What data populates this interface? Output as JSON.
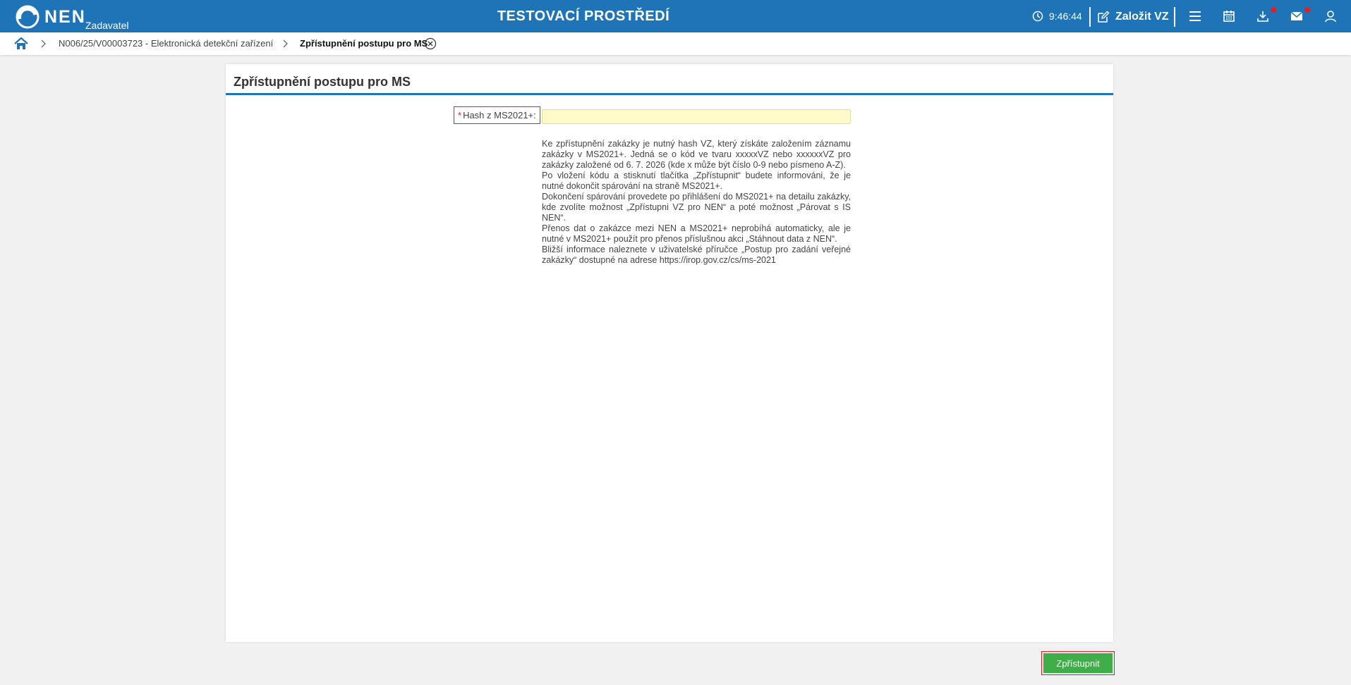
{
  "header": {
    "brand": "NEN",
    "role": "Zadavatel",
    "environment_title": "TESTOVACÍ PROSTŘEDÍ",
    "time": "9:46:44",
    "create_label": "Založit VZ",
    "icons": [
      "clock-icon",
      "edit-icon",
      "menu-icon",
      "calendar-icon",
      "download-icon",
      "mail-icon",
      "user-icon"
    ],
    "accent_color": "#1f73b7"
  },
  "breadcrumb": {
    "items": [
      "N006/25/V00003723 - Elektronická detekční zařízení",
      "Zpřístupnění postupu pro MS"
    ]
  },
  "panel": {
    "title": "Zpřístupnění postupu pro MS",
    "field": {
      "label": "Hash z MS2021+:",
      "required_mark": "*",
      "value": "",
      "placeholder": ""
    },
    "info": [
      "Ke zpřístupnění zakázky je nutný hash VZ, který získáte založením záznamu zakázky v MS2021+. Jedná se o kód ve tvaru xxxxxVZ nebo xxxxxxVZ pro zakázky založené od 6. 7. 2026 (kde x může být číslo 0-9 nebo písmeno A-Z).",
      "Po vložení kódu a stisknutí tlačítka „Zpřístupnit“ budete informováni, že je nutné dokončit spárování na straně MS2021+.",
      "Dokončení spárování provedete po přihlášení do MS2021+ na detailu zakázky, kde zvolíte možnost „Zpřístupni VZ pro NEN“ a poté možnost „Párovat s IS NEN“.",
      "Přenos dat o zakázce mezi NEN a MS2021+ neprobíhá automaticky, ale je nutné v MS2021+ použít pro přenos příslušnou akci „Stáhnout data z NEN“.",
      "Bližší informace naleznete v uživatelské příručce „Postup pro zadání veřejné zakázky“ dostupné na adrese https://irop.gov.cz/cs/ms-2021"
    ]
  },
  "actions": {
    "submit_label": "Zpřístupnit",
    "submit_color": "#3fae49"
  }
}
